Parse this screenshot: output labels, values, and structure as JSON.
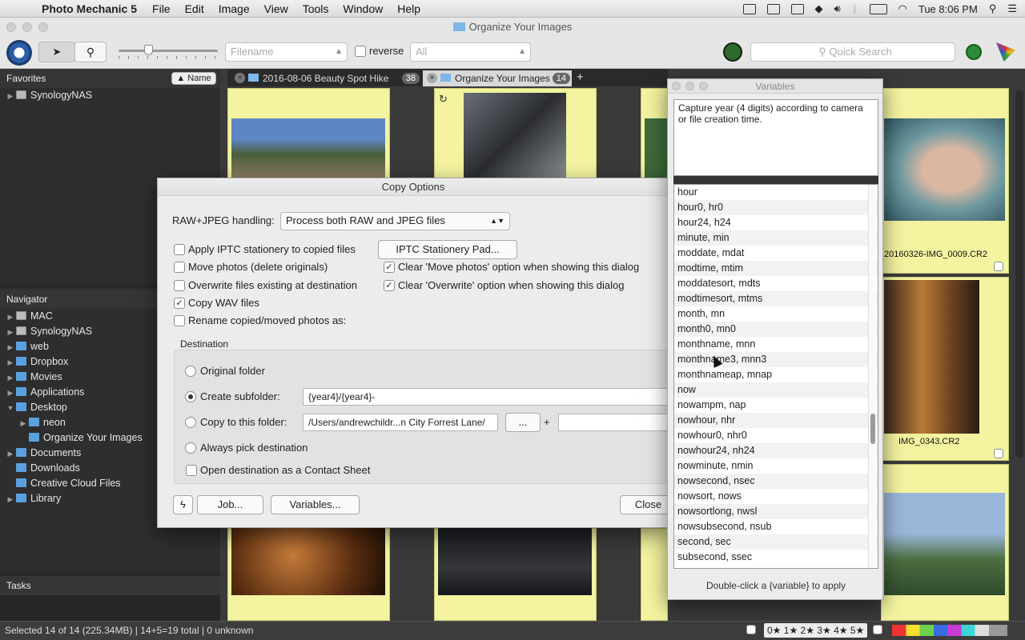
{
  "menubar": {
    "app": "Photo Mechanic 5",
    "items": [
      "File",
      "Edit",
      "Image",
      "View",
      "Tools",
      "Window",
      "Help"
    ],
    "clock": "Tue 8:06 PM"
  },
  "window": {
    "title": "Organize Your Images"
  },
  "toolbar": {
    "sort_field": "Filename",
    "reverse_label": "reverse",
    "filter": "All",
    "search_placeholder": "Quick Search"
  },
  "sidebar": {
    "favorites_title": "Favorites",
    "sort_button": "▲ Name",
    "favorites": [
      "SynologyNAS"
    ],
    "navigator_title": "Navigator",
    "navigator": [
      {
        "label": "MAC",
        "indent": 0,
        "tri": "▶",
        "kind": "drive"
      },
      {
        "label": "SynologyNAS",
        "indent": 0,
        "tri": "▶",
        "kind": "drive"
      },
      {
        "label": "web",
        "indent": 0,
        "tri": "▶",
        "kind": "folder"
      },
      {
        "label": "Dropbox",
        "indent": 0,
        "tri": "▶",
        "kind": "folder"
      },
      {
        "label": "Movies",
        "indent": 0,
        "tri": "▶",
        "kind": "folder"
      },
      {
        "label": "Applications",
        "indent": 0,
        "tri": "▶",
        "kind": "folder"
      },
      {
        "label": "Desktop",
        "indent": 0,
        "tri": "▼",
        "kind": "folder"
      },
      {
        "label": "neon",
        "indent": 1,
        "tri": "▶",
        "kind": "folder"
      },
      {
        "label": "Organize Your Images",
        "indent": 1,
        "tri": "",
        "kind": "folder"
      },
      {
        "label": "Documents",
        "indent": 0,
        "tri": "▶",
        "kind": "folder"
      },
      {
        "label": "Downloads",
        "indent": 0,
        "tri": "",
        "kind": "folder"
      },
      {
        "label": "Creative Cloud Files",
        "indent": 0,
        "tri": "",
        "kind": "folder"
      },
      {
        "label": "Library",
        "indent": 0,
        "tri": "▶",
        "kind": "folder"
      }
    ],
    "tasks_title": "Tasks"
  },
  "tabs": [
    {
      "label": "2016-08-06 Beauty Spot Hike",
      "count": "38"
    },
    {
      "label": "Organize Your Images",
      "count": "14"
    }
  ],
  "thumbnails": {
    "caption1": "20160326-IMG_0009.CR2",
    "caption2": "IMG_0343.CR2"
  },
  "status": {
    "text": "Selected 14 of 14 (225.34MB) | 14+5=19 total | 0 unknown",
    "stars": "0★ 1★ 2★ 3★ 4★ 5★"
  },
  "dialog": {
    "title": "Copy Options",
    "raw_label": "RAW+JPEG handling:",
    "raw_value": "Process both RAW and JPEG files",
    "apply_iptc": "Apply IPTC stationery to copied files",
    "iptc_button": "IPTC Stationery Pad...",
    "move_photos": "Move photos (delete originals)",
    "clear_move": "Clear 'Move photos' option when showing this dialog",
    "overwrite": "Overwrite files existing at destination",
    "clear_overwrite": "Clear 'Overwrite' option when showing this dialog",
    "copy_wav": "Copy WAV files",
    "rename": "Rename copied/moved photos as:",
    "destination": "Destination",
    "original_folder": "Original folder",
    "create_subfolder": "Create subfolder:",
    "subfolder_value": "{year4}/{year4}-",
    "copy_to_folder": "Copy to this folder:",
    "folder_value": "/Users/andrewchildr...n City Forrest Lane/",
    "browse": "...",
    "plus": "+",
    "always_pick": "Always pick destination",
    "open_contact": "Open destination as a Contact Sheet",
    "job_button": "Job...",
    "variables_button": "Variables...",
    "close_button": "Close"
  },
  "variables": {
    "title": "Variables",
    "description": "Capture year (4 digits) according to camera or file creation time.",
    "items": [
      "hour",
      "hour0, hr0",
      "hour24, h24",
      "minute, min",
      "moddate, mdat",
      "modtime, mtim",
      "moddatesort, mdts",
      "modtimesort, mtms",
      "month, mn",
      "month0, mn0",
      "monthname, mnn",
      "monthname3, mnn3",
      "monthnameap, mnap",
      "now",
      "nowampm, nap",
      "nowhour, nhr",
      "nowhour0, nhr0",
      "nowhour24, nh24",
      "nowminute, nmin",
      "nowsecond, nsec",
      "nowsort, nows",
      "nowsortlong, nwsl",
      "nowsubsecond, nsub",
      "second, sec",
      "subsecond, ssec"
    ],
    "hint": "Double-click a {variable} to apply"
  }
}
